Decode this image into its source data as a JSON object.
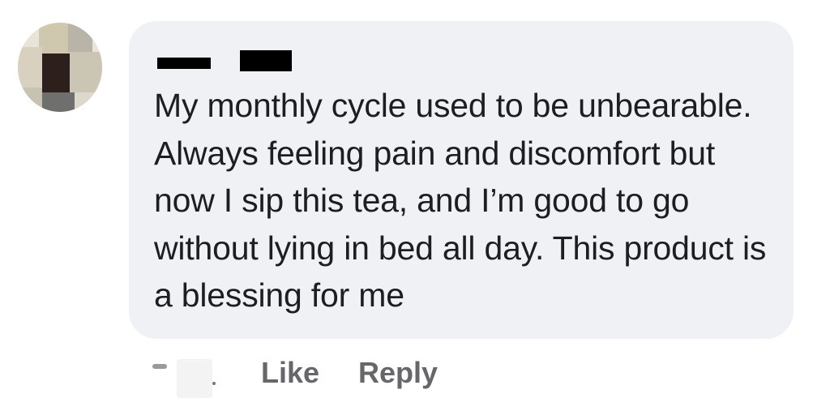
{
  "comment": {
    "author_name": "",
    "text": "My monthly cycle used to be unbearable. Always feeling pain and discomfort but now I sip this tea, and I’m good to go without lying in bed all day. This product is a blessing for me",
    "timestamp": ""
  },
  "actions": {
    "like_label": "Like",
    "reply_label": "Reply"
  },
  "colors": {
    "bubble_bg": "#f0f1f4",
    "text": "#1c1e21",
    "action_text": "#65676b"
  }
}
